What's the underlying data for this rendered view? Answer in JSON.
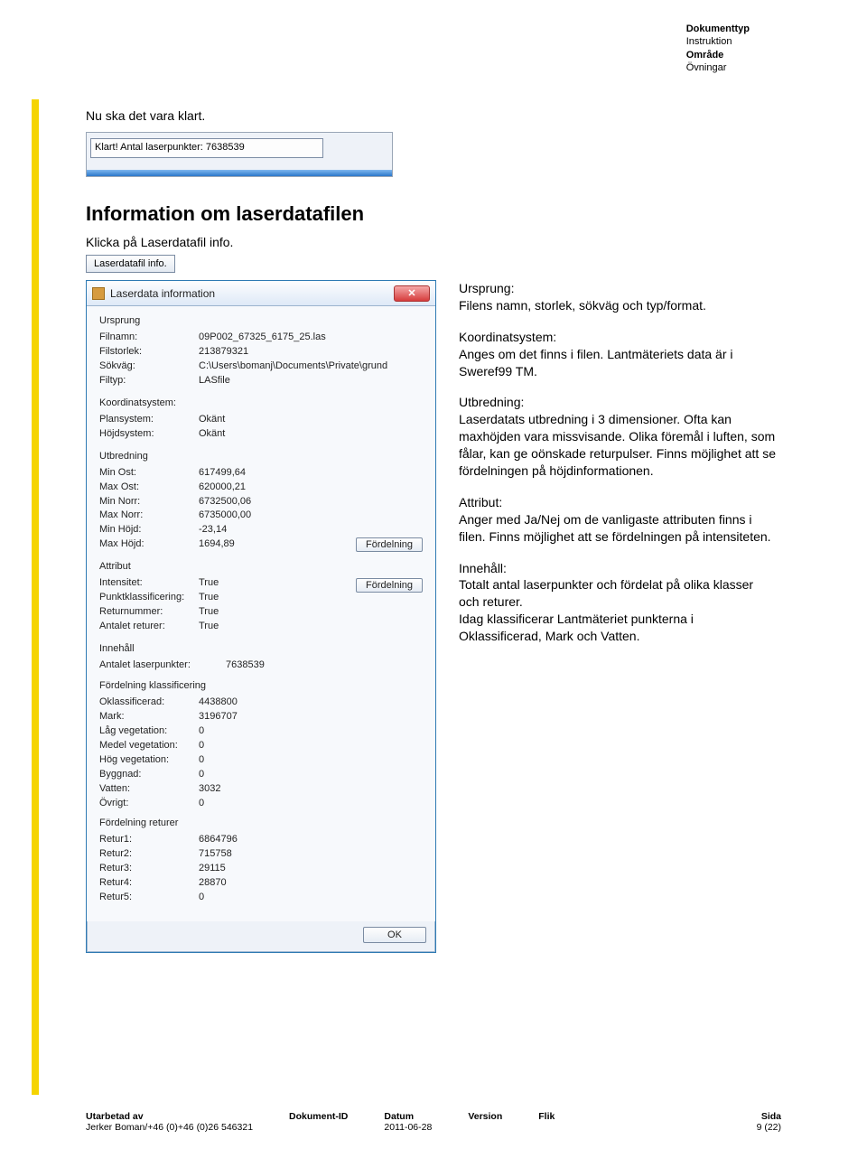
{
  "header": {
    "doc_type_label": "Dokumenttyp",
    "doc_type": "Instruktion",
    "area_label": "Område",
    "area": "Övningar"
  },
  "intro": "Nu ska det vara klart.",
  "statusbar_text": "Klart! Antal laserpunkter: 7638539",
  "section_title": "Information om laserdatafilen",
  "click_text": "Klicka på Laserdatafil info.",
  "info_button_label": "Laserdatafil info.",
  "dialog": {
    "title": "Laserdata information",
    "close_glyph": "✕",
    "ursprung": {
      "heading": "Ursprung",
      "filnamn_k": "Filnamn:",
      "filnamn_v": "09P002_67325_6175_25.las",
      "filstorlek_k": "Filstorlek:",
      "filstorlek_v": "213879321",
      "sokvag_k": "Sökväg:",
      "sokvag_v": "C:\\Users\\bomanj\\Documents\\Private\\grund",
      "filtyp_k": "Filtyp:",
      "filtyp_v": "LASfile"
    },
    "koord": {
      "heading": "Koordinatsystem:",
      "plan_k": "Plansystem:",
      "plan_v": "Okänt",
      "hojd_k": "Höjdsystem:",
      "hojd_v": "Okänt"
    },
    "utbredning": {
      "heading": "Utbredning",
      "minost_k": "Min Ost:",
      "minost_v": "617499,64",
      "maxost_k": "Max Ost:",
      "maxost_v": "620000,21",
      "minnorr_k": "Min Norr:",
      "minnorr_v": "6732500,06",
      "maxnorr_k": "Max Norr:",
      "maxnorr_v": "6735000,00",
      "minhojd_k": "Min Höjd:",
      "minhojd_v": "-23,14",
      "maxhojd_k": "Max Höjd:",
      "maxhojd_v": "1694,89",
      "btn": "Fördelning"
    },
    "attribut": {
      "heading": "Attribut",
      "intensitet_k": "Intensitet:",
      "intensitet_v": "True",
      "punktklass_k": "Punktklassificering:",
      "punktklass_v": "True",
      "returnr_k": "Returnummer:",
      "returnr_v": "True",
      "antret_k": "Antalet returer:",
      "antret_v": "True",
      "btn": "Fördelning"
    },
    "innehall": {
      "heading": "Innehåll",
      "antal_k": "Antalet laserpunkter:",
      "antal_v": "7638539",
      "klass_heading": "Fördelning klassificering",
      "oklass_k": "Oklassificerad:",
      "oklass_v": "4438800",
      "mark_k": "Mark:",
      "mark_v": "3196707",
      "lagveg_k": "Låg vegetation:",
      "lagveg_v": "0",
      "medveg_k": "Medel vegetation:",
      "medveg_v": "0",
      "hogveg_k": "Hög vegetation:",
      "hogveg_v": "0",
      "byggnad_k": "Byggnad:",
      "byggnad_v": "0",
      "vatten_k": "Vatten:",
      "vatten_v": "3032",
      "ovrigt_k": "Övrigt:",
      "ovrigt_v": "0",
      "retur_heading": "Fördelning returer",
      "r1_k": "Retur1:",
      "r1_v": "6864796",
      "r2_k": "Retur2:",
      "r2_v": "715758",
      "r3_k": "Retur3:",
      "r3_v": "29115",
      "r4_k": "Retur4:",
      "r4_v": "28870",
      "r5_k": "Retur5:",
      "r5_v": "0"
    },
    "ok": "OK"
  },
  "desc": {
    "p1": "Ursprung:\nFilens namn, storlek, sökväg och typ/format.",
    "p2": "Koordinatsystem:\nAnges om det finns i filen. Lantmäteriets data är i Sweref99 TM.",
    "p3": "Utbredning:\nLaserdatats utbredning i 3 dimensioner. Ofta kan maxhöjden vara missvisande. Olika föremål i luften, som fålar, kan ge oönskade returpulser. Finns möjlighet att se fördelningen på höjdinformationen.",
    "p4": "Attribut:\nAnger med Ja/Nej om de vanligaste attributen finns i filen. Finns möjlighet att se fördelningen på intensiteten.",
    "p5": "Innehåll:\nTotalt antal laserpunkter och fördelat på olika klasser och returer.\nIdag klassificerar Lantmäteriet punkterna i Oklassificerad, Mark och Vatten."
  },
  "footer": {
    "utarbetad_lbl": "Utarbetad av",
    "utarbetad_val": "Jerker Boman/+46 (0)+46 (0)26 546321",
    "docid_lbl": "Dokument-ID",
    "datum_lbl": "Datum",
    "datum_val": "2011-06-28",
    "version_lbl": "Version",
    "flik_lbl": "Flik",
    "sida_lbl": "Sida",
    "sida_val": "9 (22)"
  }
}
